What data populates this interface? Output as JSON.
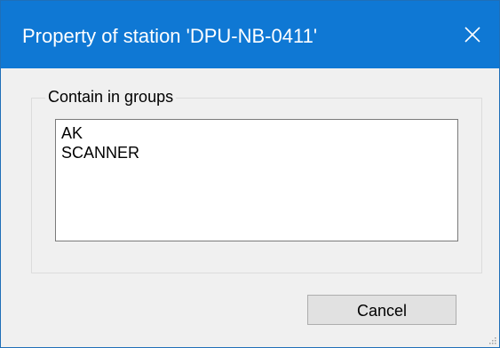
{
  "window": {
    "title": "Property of station 'DPU-NB-0411'",
    "close_label": "close"
  },
  "groups_box": {
    "label": "Contain in groups",
    "items": [
      "AK",
      "SCANNER"
    ]
  },
  "buttons": {
    "cancel_label": "Cancel"
  },
  "colors": {
    "titlebar": "#0f78d4",
    "dialog_background": "#f0f0f0",
    "button_face": "#e1e1e1"
  },
  "icons": {
    "close": "close-icon",
    "resize_grip": "resize-grip-icon"
  }
}
